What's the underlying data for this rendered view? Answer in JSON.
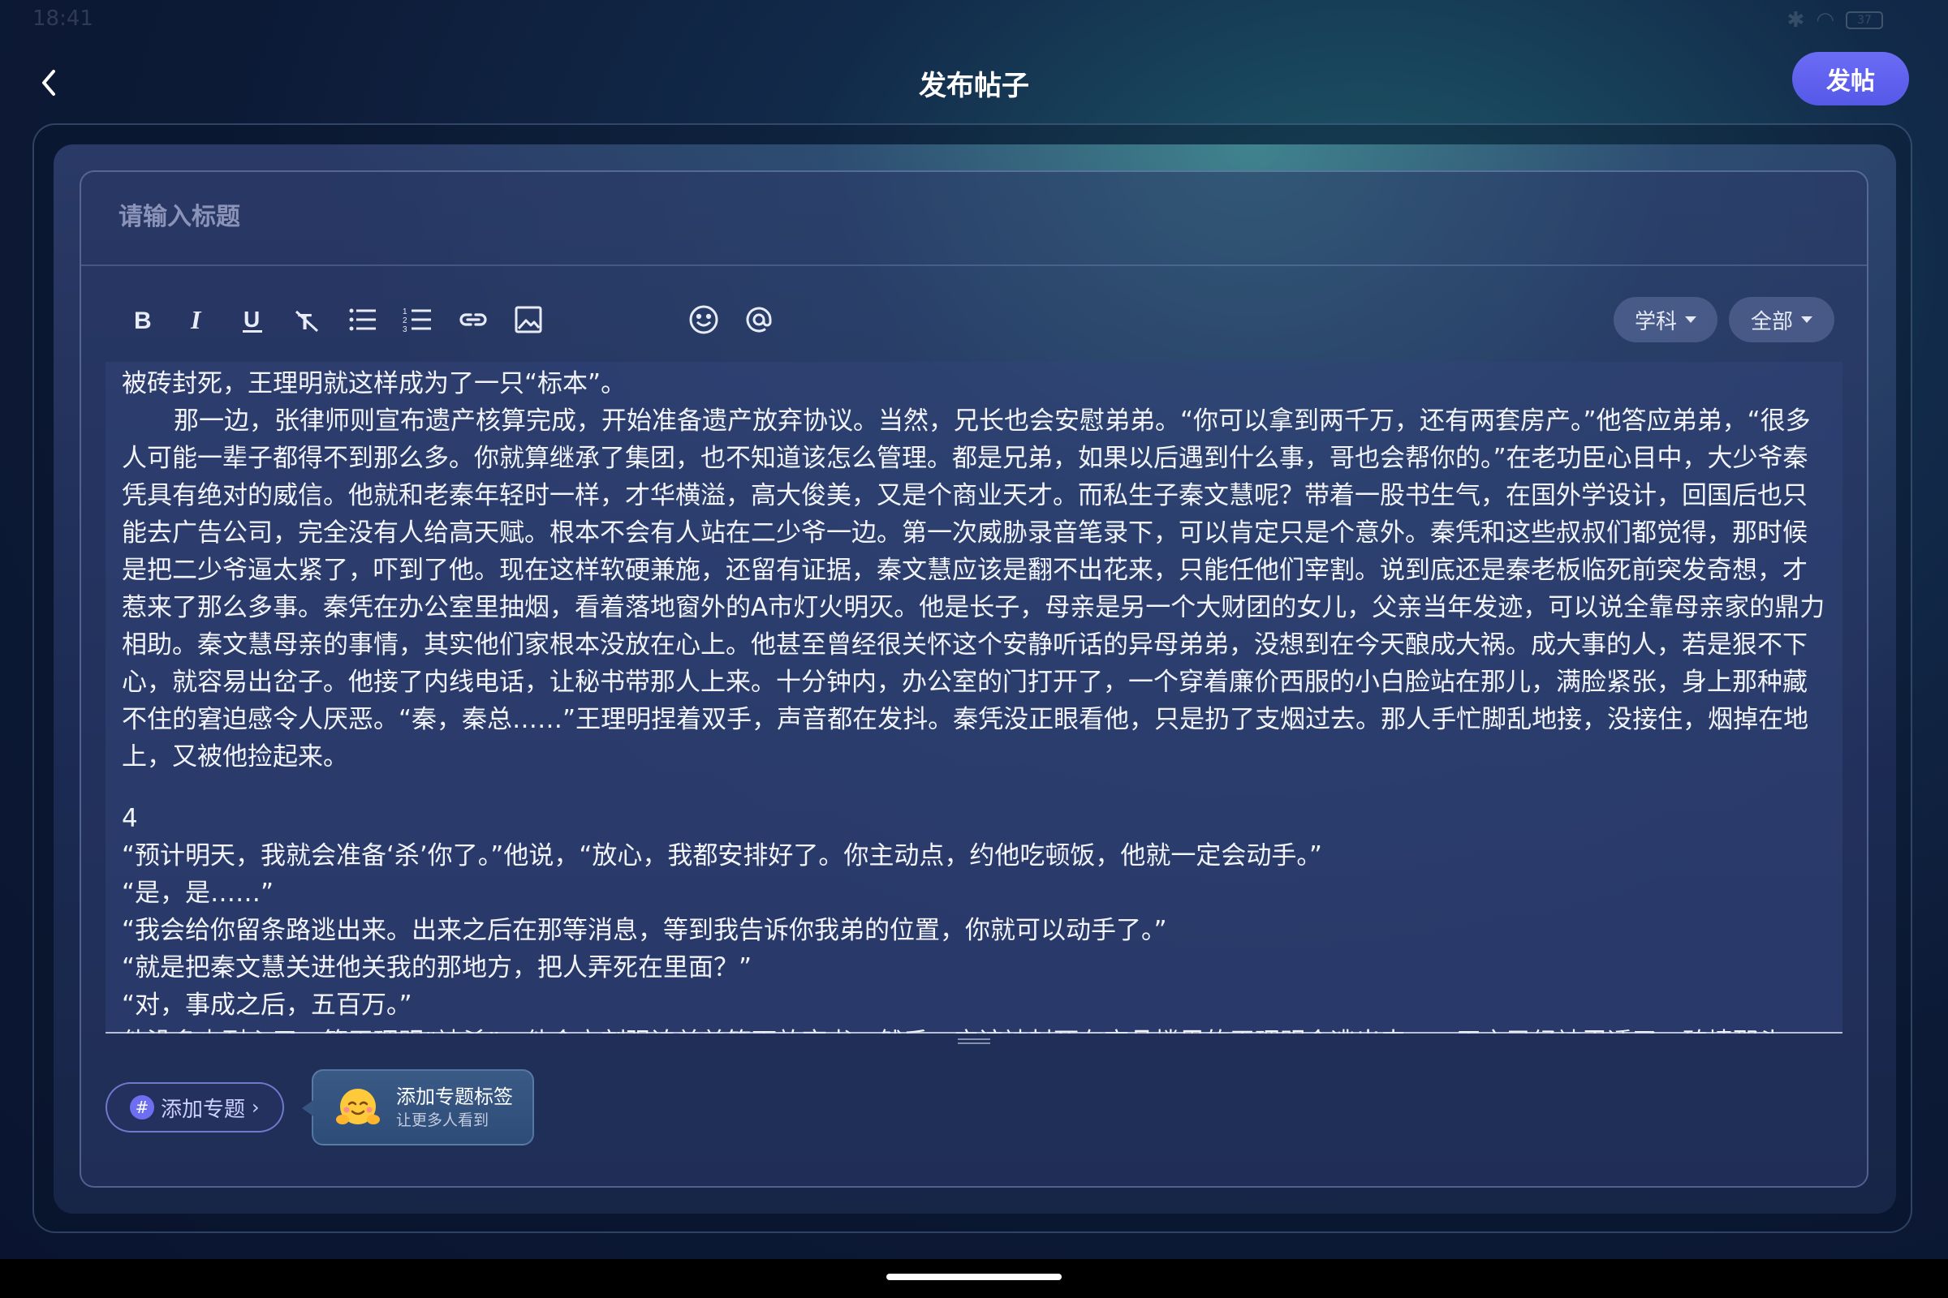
{
  "status_bar": {
    "time": "18:41",
    "battery": "37"
  },
  "header": {
    "title": "发布帖子",
    "publish_label": "发帖"
  },
  "form": {
    "title_placeholder": "请输入标题"
  },
  "toolbar": {
    "tools": [
      "bold-icon",
      "italic-icon",
      "underline-icon",
      "clear-format-icon",
      "bullet-list-icon",
      "numbered-list-icon",
      "link-icon",
      "image-icon",
      "emoji-icon",
      "mention-icon"
    ],
    "subject_label": "学科",
    "scope_label": "全部"
  },
  "editor": {
    "paragraphs": [
      "被砖封死，王理明就这样成为了一只“标本”。",
      "那一边，张律师则宣布遗产核算完成，开始准备遗产放弃协议。当然，兄长也会安慰弟弟。“你可以拿到两千万，还有两套房产。”他答应弟弟，“很多人可能一辈子都得不到那么多。你就算继承了集团，也不知道该怎么管理。都是兄弟，如果以后遇到什么事，哥也会帮你的。”在老功臣心目中，大少爷秦凭具有绝对的威信。他就和老秦年轻时一样，才华横溢，高大俊美，又是个商业天才。而私生子秦文慧呢？带着一股书生气，在国外学设计，回国后也只能去广告公司，完全没有人给高天赋。根本不会有人站在二少爷一边。第一次威胁录音笔录下，可以肯定只是个意外。秦凭和这些叔叔们都觉得，那时候是把二少爷逼太紧了，吓到了他。现在这样软硬兼施，还留有证据，秦文慧应该是翻不出花来，只能任他们宰割。说到底还是秦老板临死前突发奇想，才惹来了那么多事。秦凭在办公室里抽烟，看着落地窗外的A市灯火明灭。他是长子，母亲是另一个大财团的女儿，父亲当年发迹，可以说全靠母亲家的鼎力相助。秦文慧母亲的事情，其实他们家根本没放在心上。他甚至曾经很关怀这个安静听话的异母弟弟，没想到在今天酿成大祸。成大事的人，若是狠不下心，就容易出岔子。他接了内线电话，让秘书带那人上来。十分钟内，办公室的门打开了，一个穿着廉价西服的小白脸站在那儿，满脸紧张，身上那种藏不住的窘迫感令人厌恶。“秦，秦总……”王理明捏着双手，声音都在发抖。秦凭没正眼看他，只是扔了支烟过去。那人手忙脚乱地接，没接住，烟掉在地上，又被他捡起来。",
      "4",
      "“预计明天，我就会准备‘杀’你了。”他说，“放心，我都安排好了。你主动点，约他吃顿饭，他就一定会动手。”",
      "“是，是……”",
      "“我会给你留条路逃出来。出来之后在那等消息，等到我告诉你我弟的位置，你就可以动手了。”",
      "“就是把秦文慧关进他关我的那地方，把人弄死在里面？”",
      "“对，事成之后，五百万。”",
      "他没多少耐心了，等王理明“被杀”，他会立刻强迫弟弟签下放弃书，然后，应该被封死在商品楼里的王理明会逃出来，一天之已经被忍透了，砖墙那头"
    ]
  },
  "footer": {
    "add_topic_label": "添加专题",
    "tip_title": "添加专题标签",
    "tip_subtitle": "让更多人看到"
  },
  "colors": {
    "accent": "#5658e8",
    "background": "#0c1a36",
    "panel": "#2a3a66"
  }
}
